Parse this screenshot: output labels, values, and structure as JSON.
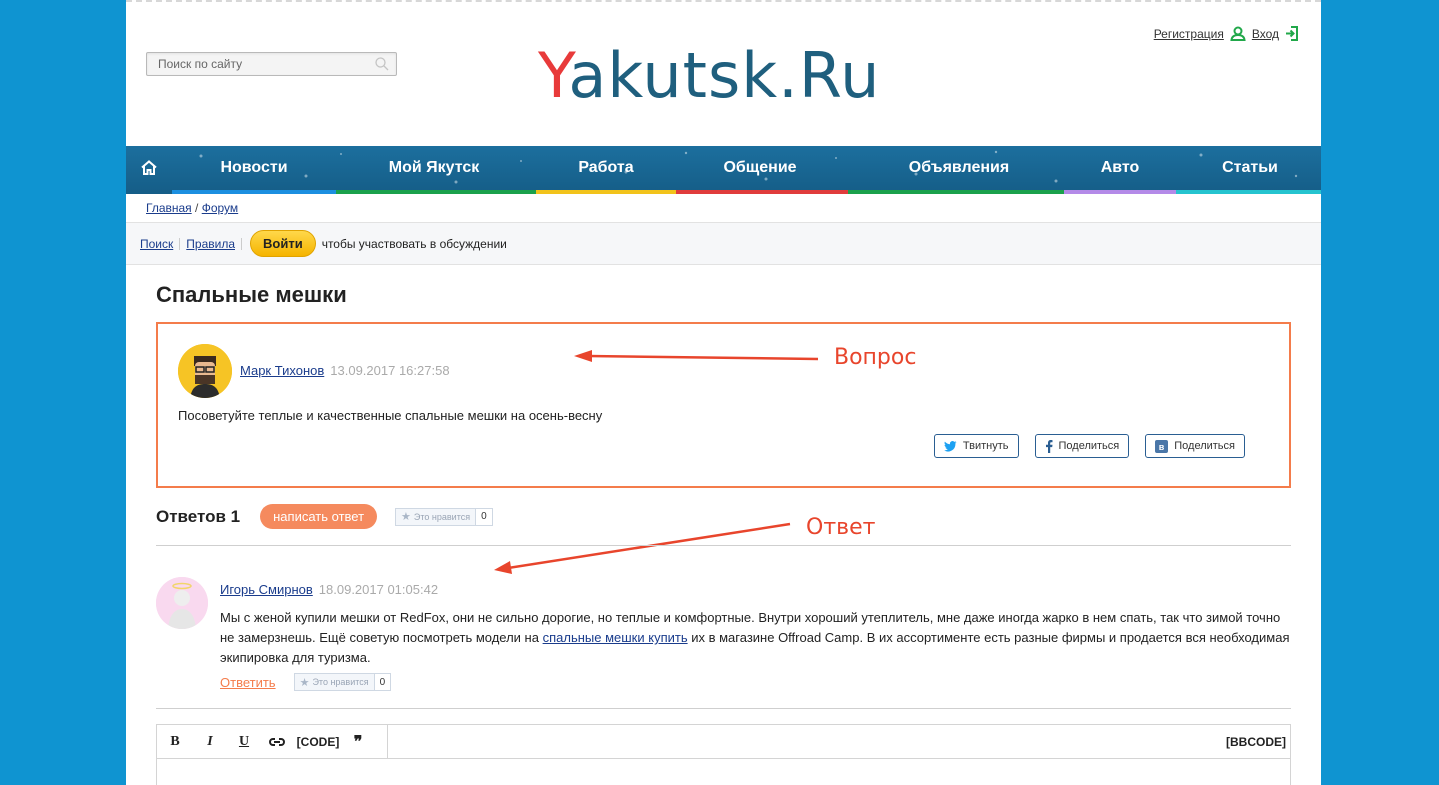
{
  "header": {
    "search_placeholder": "Поиск по сайту",
    "logo_first": "Y",
    "logo_rest": "akutsk.Ru",
    "register": "Регистрация",
    "login": "Вход"
  },
  "nav": {
    "items": [
      "Новости",
      "Мой Якутск",
      "Работа",
      "Общение",
      "Объявления",
      "Авто",
      "Статьи"
    ],
    "underline_colors": [
      "#1c8fe0",
      "#1aa14c",
      "#f2c31b",
      "#e03c3c",
      "#1aa14c",
      "#b48ae8",
      "#25c4cf"
    ]
  },
  "breadcrumb": {
    "home": "Главная",
    "separator": "/",
    "forum": "Форум"
  },
  "toolbar": {
    "search": "Поиск",
    "rules": "Правила",
    "login_button": "Войти",
    "prompt": "чтобы участвовать в обсуждении"
  },
  "topic": {
    "title": "Спальные мешки",
    "question": {
      "author": "Марк Тихонов",
      "date": "13.09.2017 16:27:58",
      "text": "Посоветуйте теплые и качественные спальные мешки на осень-весну"
    },
    "share": {
      "twitter": "Твитнуть",
      "facebook": "Поделиться",
      "vk": "Поделиться"
    }
  },
  "annotations": {
    "question": "Вопрос",
    "answer": "Ответ"
  },
  "answers": {
    "count_label": "Ответов 1",
    "write_button": "написать ответ",
    "like_label": "Это нравится",
    "like_count": "0",
    "items": [
      {
        "author": "Игорь Смирнов",
        "date": "18.09.2017 01:05:42",
        "text_before": "Мы с женой купили мешки от RedFox, они не сильно дорогие, но теплые и комфортные. Внутри хороший утеплитель, мне даже иногда жарко в нем спать, так что зимой точно не замерзнешь. Ещё советую посмотреть модели на ",
        "link": "спальные мешки купить",
        "text_after": " их в магазине Offroad Camp. В их ассортименте есть разные фирмы и продается вся необходимая экипировка для туризма.",
        "reply": "Ответить",
        "like_label": "Это нравится",
        "like_count": "0"
      }
    ]
  },
  "editor": {
    "bold": "B",
    "italic": "I",
    "underline": "U",
    "code": "[CODE]",
    "quote": "❞",
    "bbcode": "[BBCODE]"
  }
}
